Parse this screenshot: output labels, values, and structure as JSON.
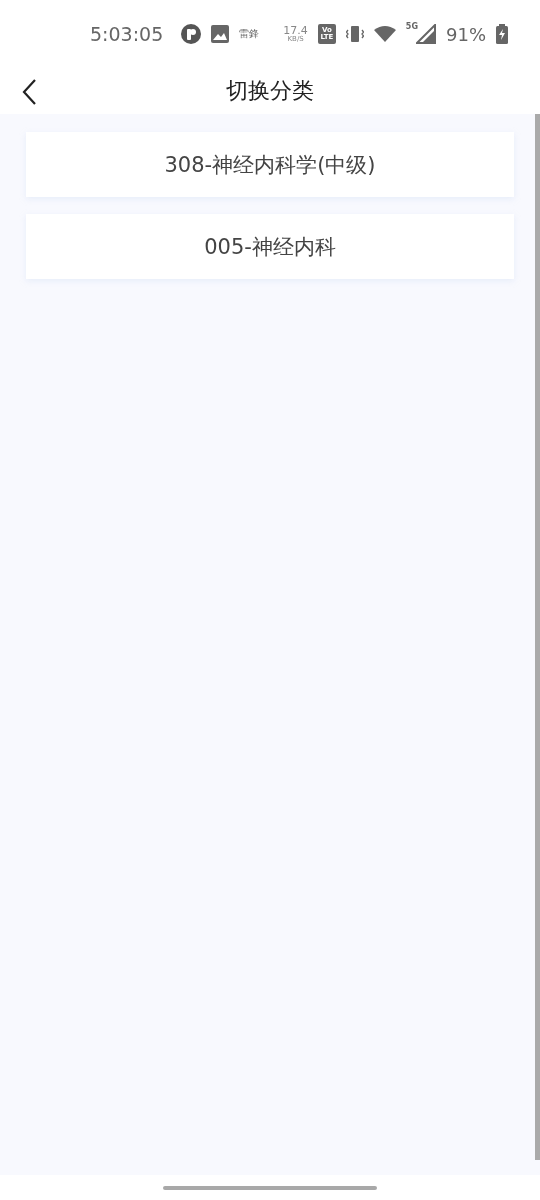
{
  "status_bar": {
    "time": "5:03:05",
    "notification_text": "雷鋒",
    "speed_value": "17.4",
    "speed_unit": "KB/S",
    "volte_top": "Vo",
    "volte_bottom": "LTE",
    "network": "5G",
    "battery": "91%"
  },
  "header": {
    "title": "切换分类"
  },
  "categories": [
    {
      "label": "308-神经内科学(中级)"
    },
    {
      "label": "005-神经内科"
    }
  ]
}
